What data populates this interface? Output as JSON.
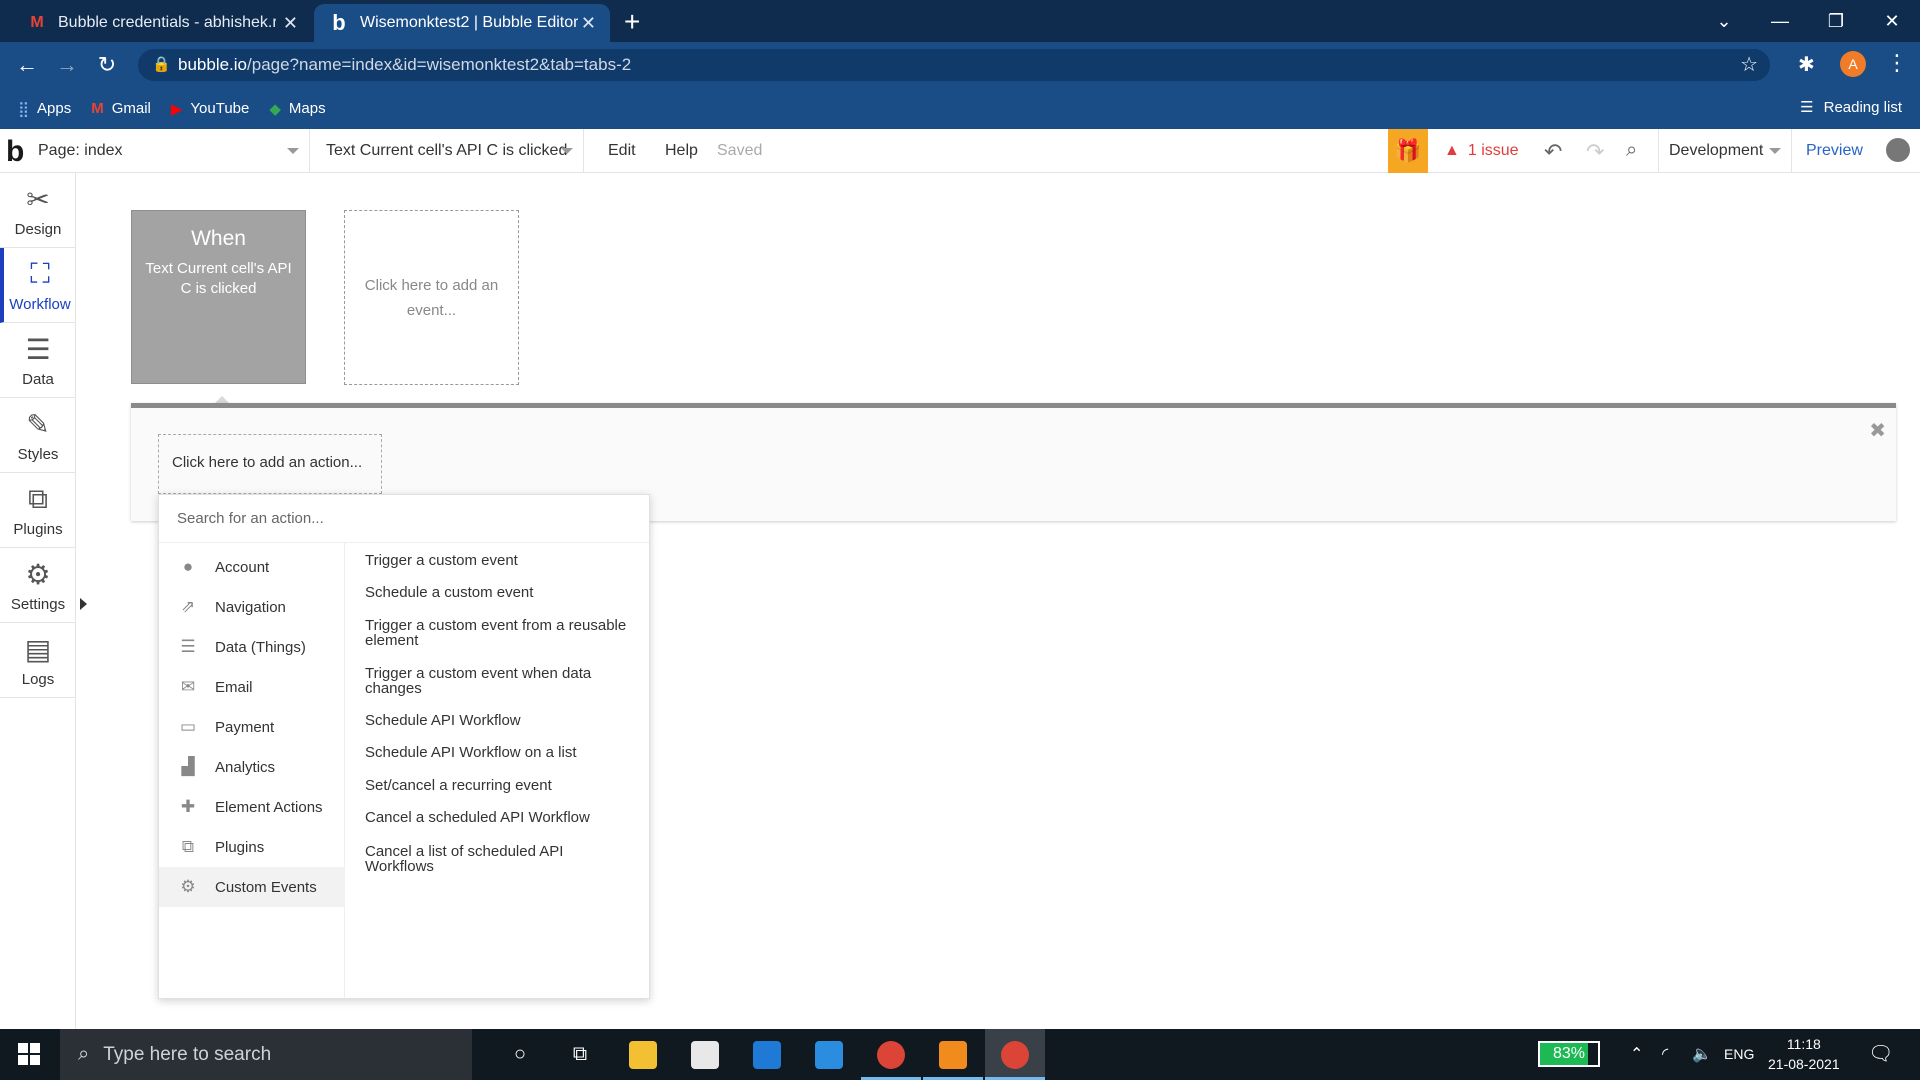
{
  "browser": {
    "tabs": [
      {
        "title": "Bubble credentials - abhishek.ran",
        "favicon": "gmail-icon",
        "active": false
      },
      {
        "title": "Wisemonktest2 | Bubble Editor",
        "favicon": "bubble-icon",
        "active": true
      }
    ],
    "new_tab": "+",
    "url_host": "bubble.io",
    "url_path": "/page?name=index&id=wisemonktest2&tab=tabs-2",
    "profile_initial": "A",
    "bookmarks": [
      {
        "label": "Apps",
        "icon": "apps-grid-icon"
      },
      {
        "label": "Gmail",
        "icon": "gmail-icon"
      },
      {
        "label": "YouTube",
        "icon": "youtube-icon"
      },
      {
        "label": "Maps",
        "icon": "maps-icon"
      }
    ],
    "reading_list": "Reading list"
  },
  "editor": {
    "page_label": "Page: index",
    "event_selector": "Text Current cell's API C is clicked",
    "menu": [
      "Edit",
      "Help"
    ],
    "saved_status": "Saved",
    "issue_count": "1 issue",
    "environment": "Development",
    "preview": "Preview",
    "accent": "#f5a623",
    "issue_color": "#e23b3b"
  },
  "sidebar": {
    "items": [
      {
        "label": "Design",
        "icon": "design-tools-icon"
      },
      {
        "label": "Workflow",
        "icon": "workflow-icon",
        "active": true
      },
      {
        "label": "Data",
        "icon": "database-icon"
      },
      {
        "label": "Styles",
        "icon": "brush-icon"
      },
      {
        "label": "Plugins",
        "icon": "plugins-icon"
      },
      {
        "label": "Settings",
        "icon": "gear-icon"
      },
      {
        "label": "Logs",
        "icon": "document-icon"
      }
    ]
  },
  "workflow": {
    "event_heading": "When",
    "event_description": "Text Current cell's API C is clicked",
    "add_event": "Click here to add an event...",
    "add_action": "Click here to add an action..."
  },
  "action_menu": {
    "search_placeholder": "Search for an action...",
    "categories": [
      {
        "label": "Account",
        "icon": "account-icon"
      },
      {
        "label": "Navigation",
        "icon": "navigation-icon"
      },
      {
        "label": "Data (Things)",
        "icon": "database-icon"
      },
      {
        "label": "Email",
        "icon": "email-icon"
      },
      {
        "label": "Payment",
        "icon": "payment-icon"
      },
      {
        "label": "Analytics",
        "icon": "analytics-icon"
      },
      {
        "label": "Element Actions",
        "icon": "element-actions-icon"
      },
      {
        "label": "Plugins",
        "icon": "plugins-icon"
      },
      {
        "label": "Custom Events",
        "icon": "gears-icon",
        "selected": true
      }
    ],
    "actions": [
      "Trigger a custom event",
      "Schedule a custom event",
      "Trigger a custom event from a reusable element",
      "Trigger a custom event when data changes",
      "Schedule API Workflow",
      "Schedule API Workflow on a list",
      "Set/cancel a recurring event",
      "Cancel a scheduled API Workflow",
      "Cancel a list of scheduled API Workflows"
    ]
  },
  "taskbar": {
    "search_placeholder": "Type here to search",
    "battery": "83%",
    "battery_level": 0.83,
    "language": "ENG",
    "time": "11:18",
    "date": "21-08-2021"
  }
}
